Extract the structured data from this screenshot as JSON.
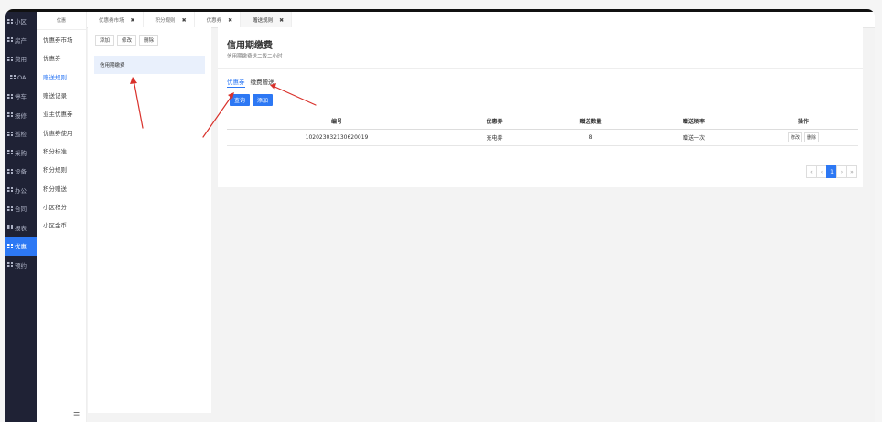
{
  "rail": {
    "items": [
      {
        "label": "小区",
        "active": false
      },
      {
        "label": "房产",
        "active": false
      },
      {
        "label": "费用",
        "active": false
      },
      {
        "label": "OA",
        "active": false
      },
      {
        "label": "停车",
        "active": false
      },
      {
        "label": "报修",
        "active": false
      },
      {
        "label": "巡检",
        "active": false
      },
      {
        "label": "采购",
        "active": false
      },
      {
        "label": "设备",
        "active": false
      },
      {
        "label": "办公",
        "active": false
      },
      {
        "label": "合同",
        "active": false
      },
      {
        "label": "报表",
        "active": false
      },
      {
        "label": "优惠",
        "active": true
      },
      {
        "label": "预约",
        "active": false
      }
    ]
  },
  "submenu": {
    "header": "优惠",
    "items": [
      {
        "label": "优惠券市场",
        "active": false
      },
      {
        "label": "优惠券",
        "active": false
      },
      {
        "label": "赠送规则",
        "active": true
      },
      {
        "label": "赠送记录",
        "active": false
      },
      {
        "label": "业主优惠券",
        "active": false
      },
      {
        "label": "优惠券使用",
        "active": false
      },
      {
        "label": "积分标准",
        "active": false
      },
      {
        "label": "积分规则",
        "active": false
      },
      {
        "label": "积分赠送",
        "active": false
      },
      {
        "label": "小区积分",
        "active": false
      },
      {
        "label": "小区金币",
        "active": false
      }
    ],
    "footer_icon": "menu-collapse-icon"
  },
  "tabs": [
    {
      "label": "优惠券市场",
      "active": false
    },
    {
      "label": "积分规则",
      "active": false
    },
    {
      "label": "优惠券",
      "active": false
    },
    {
      "label": "赠送规则",
      "active": true
    }
  ],
  "left_panel": {
    "add_label": "添加",
    "edit_label": "修改",
    "delete_label": "删除",
    "plans": [
      "信用期缴费"
    ]
  },
  "detail": {
    "title": "信用期缴费",
    "subtitle": "信用期缴费送二饭二小时",
    "content_tabs": [
      {
        "label": "优惠券",
        "active": true
      },
      {
        "label": "缴费赠送",
        "active": false
      }
    ],
    "query_label": "查询",
    "add_label": "添加",
    "table": {
      "headers": [
        "编号",
        "优惠券",
        "赠送数量",
        "赠送频率",
        "操作"
      ],
      "rows": [
        {
          "id": "102023032130620019",
          "coupon": "充电券",
          "qty": "8",
          "freq": "赠送一次",
          "edit": "修改",
          "delete": "删除"
        }
      ]
    },
    "pagination": {
      "first": "«",
      "prev": "‹",
      "current": "1",
      "next": "›",
      "last": "»"
    }
  },
  "colors": {
    "accent": "#2d78f4",
    "rail_bg": "#1f2235",
    "annotation": "#d9312b"
  }
}
